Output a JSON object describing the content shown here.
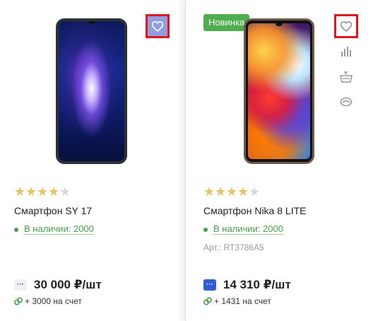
{
  "products": [
    {
      "name": "Смартфон SY 17",
      "rating": 4,
      "rating_max": 5,
      "stock": "В наличии: 2000",
      "price": "30 000 ₽/шт",
      "bonus": "+ 3000 на счет",
      "price_icon": "ellipsis-icon"
    },
    {
      "badge": "Новинка",
      "name": "Смартфон Nika 8 LITE",
      "rating": 4,
      "rating_max": 5,
      "stock": "В наличии: 2000",
      "sku": "Арт.: RT3786A5",
      "price": "14 310 ₽/шт",
      "bonus": "+ 1431 на счет",
      "price_icon": "ellipsis-icon"
    }
  ],
  "actions": {
    "favorite": "heart-icon",
    "compare": "bar-chart-icon",
    "cart": "basket-icon",
    "quick_view": "eye-icon"
  },
  "colors": {
    "stock_green": "#45a24b",
    "badge_green": "#4cae4c",
    "star_gold": "#e5c563",
    "highlight_red": "#e3141d",
    "price_icon_blue": "#2f5bd3"
  }
}
